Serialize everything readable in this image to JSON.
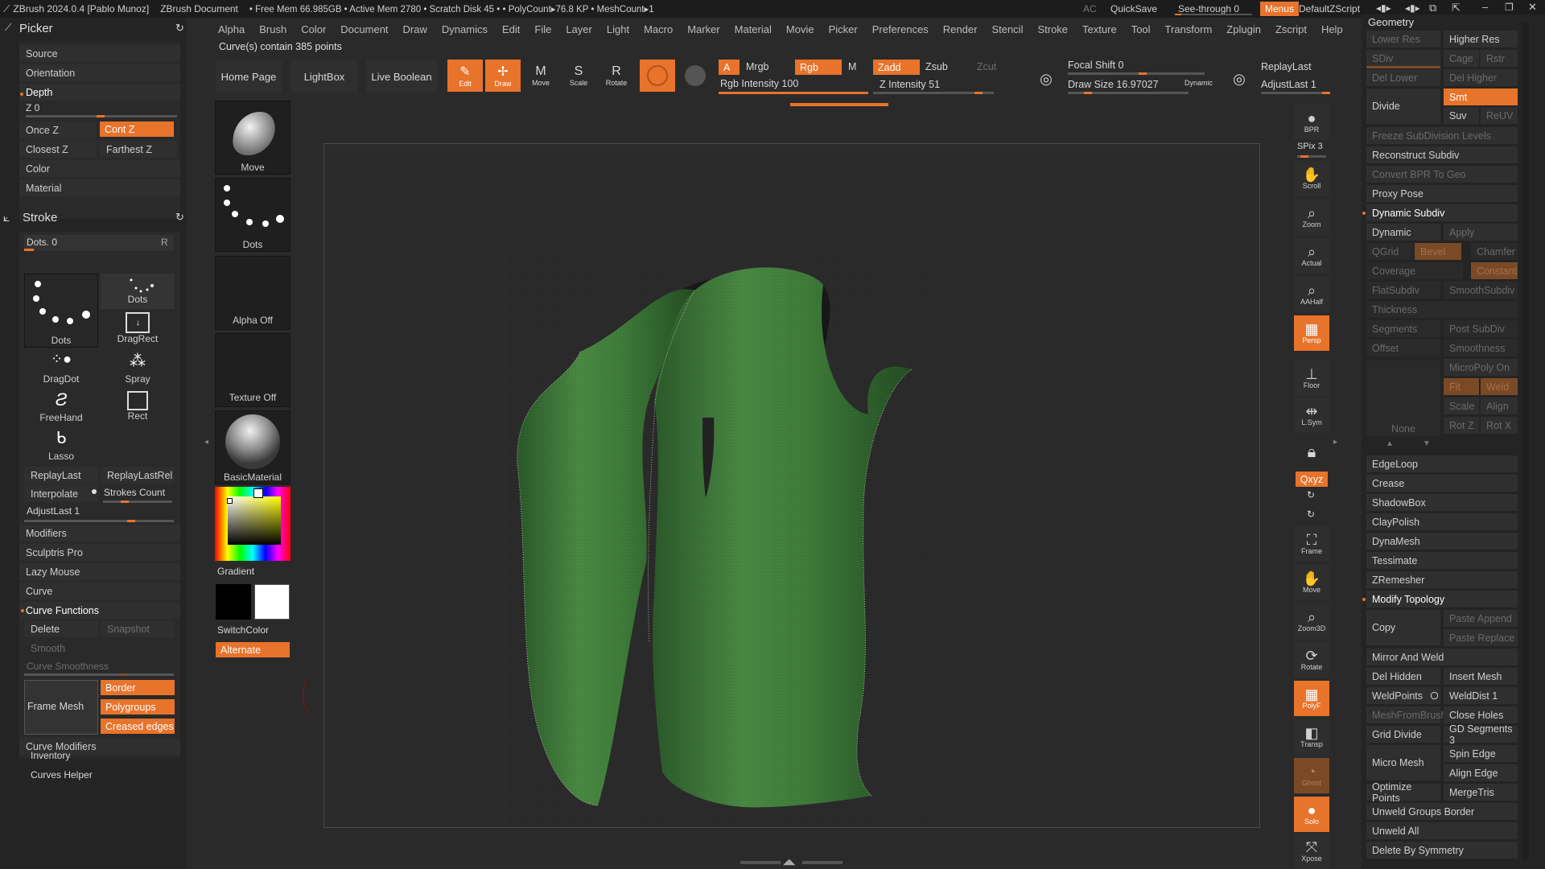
{
  "titlebar": {
    "app": "ZBrush 2024.0.4 [Pablo Munoz]",
    "document": "ZBrush Document",
    "stats": "• Free Mem 66.985GB • Active Mem 2780 • Scratch Disk 45 • • PolyCount▸76.8 KP • MeshCount▸1",
    "ac": "AC",
    "quicksave": "QuickSave",
    "see_through": "See-through  0",
    "menus": "Menus",
    "script": "DefaultZScript"
  },
  "menubar": [
    "Alpha",
    "Brush",
    "Color",
    "Document",
    "Draw",
    "Dynamics",
    "Edit",
    "File",
    "Layer",
    "Light",
    "Macro",
    "Marker",
    "Material",
    "Movie",
    "Picker",
    "Preferences",
    "Render",
    "Stencil",
    "Stroke",
    "Texture",
    "Tool",
    "Transform",
    "Zplugin",
    "Zscript",
    "Help"
  ],
  "status_message": "Curve(s) contain 385 points",
  "picker": {
    "title": "Picker",
    "source": "Source",
    "orientation": "Orientation",
    "depth": "Depth",
    "z": "Z 0",
    "once_z": "Once Z",
    "cont_z": "Cont Z",
    "closest_z": "Closest Z",
    "farthest_z": "Farthest Z",
    "color": "Color",
    "material": "Material"
  },
  "stroke": {
    "title": "Stroke",
    "dots": "Dots. 0",
    "r": "R",
    "main_stroke": "Dots",
    "types": [
      {
        "label": "Dots"
      },
      {
        "label": "DragRect"
      },
      {
        "label": "DragDot"
      },
      {
        "label": "Spray"
      },
      {
        "label": "FreeHand"
      },
      {
        "label": "Rect"
      },
      {
        "label": "Lasso"
      }
    ],
    "replay_last": "ReplayLast",
    "replay_last_rel": "ReplayLastRel",
    "interpolate": "Interpolate",
    "strokes_count": "Strokes Count",
    "adjust_last": "AdjustLast 1",
    "modifiers": "Modifiers",
    "sculptris_pro": "Sculptris Pro",
    "lazy_mouse": "Lazy Mouse",
    "curve": "Curve",
    "curve_functions": "Curve Functions",
    "delete": "Delete",
    "snapshot": "Snapshot",
    "smooth": "Smooth",
    "curve_smoothness": "Curve Smoothness",
    "frame_mesh": "Frame Mesh",
    "border": "Border",
    "polygroups": "Polygroups",
    "creased_edges": "Creased edges",
    "curve_modifiers": "Curve Modifiers",
    "inventory": "Inventory",
    "curves_helper": "Curves Helper"
  },
  "shelf": {
    "home_page": "Home Page",
    "lightbox": "LightBox",
    "live_boolean": "Live Boolean",
    "move": "Move",
    "dots": "Dots",
    "alpha_off": "Alpha Off",
    "texture_off": "Texture Off",
    "basic_material": "BasicMaterial",
    "gradient": "Gradient",
    "switch_color": "SwitchColor",
    "alternate": "Alternate"
  },
  "topbar": {
    "edit": "Edit",
    "draw": "Draw",
    "move": "Move",
    "scale": "Scale",
    "rotate": "Rotate",
    "a": "A",
    "mrgb": "Mrgb",
    "rgb": "Rgb",
    "m": "M",
    "rgb_intensity": "Rgb Intensity 100",
    "zadd": "Zadd",
    "zsub": "Zsub",
    "zcut": "Zcut",
    "z_intensity": "Z Intensity 51",
    "focal_shift": "Focal Shift 0",
    "draw_size": "Draw Size 16.97027",
    "dynamic": "Dynamic",
    "replay_last": "ReplayLast",
    "adjust_last": "AdjustLast 1"
  },
  "rtools": [
    {
      "label": "BPR"
    },
    {
      "label": "SPix 3"
    },
    {
      "label": "Scroll"
    },
    {
      "label": "Zoom"
    },
    {
      "label": "Actual"
    },
    {
      "label": "AAHalf"
    },
    {
      "label": "Persp"
    },
    {
      "label": "Floor"
    },
    {
      "label": "L.Sym"
    },
    {
      "label": "Qxyz"
    },
    {
      "label": "Frame"
    },
    {
      "label": "Move"
    },
    {
      "label": "Zoom3D"
    },
    {
      "label": "Rotate"
    },
    {
      "label": "PolyF"
    },
    {
      "label": "Transp"
    },
    {
      "label": "Ghost"
    },
    {
      "label": "Solo"
    },
    {
      "label": "Xpose"
    }
  ],
  "geometry": {
    "title": "Geometry",
    "lower_res": "Lower Res",
    "higher_res": "Higher Res",
    "sdiv": "SDiv",
    "cage": "Cage",
    "rstr": "Rstr",
    "del_lower": "Del Lower",
    "del_higher": "Del Higher",
    "divide": "Divide",
    "smt": "Smt",
    "suv": "Suv",
    "reuv": "ReUV",
    "freeze": "Freeze SubDivision Levels",
    "reconstruct": "Reconstruct Subdiv",
    "convert_bpr": "Convert BPR To Geo",
    "proxy_pose": "Proxy Pose",
    "dynamic_subdiv": "Dynamic Subdiv",
    "dynamic": "Dynamic",
    "apply": "Apply",
    "qgrid": "QGrid",
    "bevel": "Bevel",
    "chamfer": "Chamfer",
    "coverage": "Coverage",
    "constant": "Constant",
    "flat_subdiv": "FlatSubdiv",
    "smooth_subdiv": "SmoothSubdiv",
    "thickness": "Thickness",
    "segments": "Segments",
    "post_subdiv": "Post SubDiv",
    "offset": "Offset",
    "smoothness": "Smoothness",
    "micropoly_on": "MicroPoly On",
    "fit": "Fit",
    "weld": "Weld",
    "scale": "Scale",
    "align": "Align",
    "none": "None",
    "rot_z": "Rot Z",
    "rot_x": "Rot X",
    "edgeloop": "EdgeLoop",
    "crease": "Crease",
    "shadowbox": "ShadowBox",
    "claypolish": "ClayPolish",
    "dynamesh": "DynaMesh",
    "tessimate": "Tessimate",
    "zremesher": "ZRemesher",
    "modify_topology": "Modify Topology",
    "copy": "Copy",
    "paste_append": "Paste Append",
    "paste_replace": "Paste Replace",
    "mirror_weld": "Mirror And Weld",
    "del_hidden": "Del Hidden",
    "insert_mesh": "Insert Mesh",
    "weld_points": "WeldPoints",
    "weld_dist": "WeldDist 1",
    "mesh_from_brush": "MeshFromBrush",
    "close_holes": "Close Holes",
    "grid_divide": "Grid Divide",
    "gd_segments": "GD Segments 3",
    "micro_mesh": "Micro Mesh",
    "spin_edge": "Spin Edge",
    "align_edge": "Align Edge",
    "optimize_points": "Optimize Points",
    "merge_tris": "MergeTris",
    "unweld_groups": "Unweld Groups Border",
    "unweld_all": "Unweld All",
    "delete_symmetry": "Delete By Symmetry"
  },
  "colors": {
    "accent": "#e8732a",
    "mesh_green": "#3f7d3a",
    "bg": "#2a2a2a"
  }
}
